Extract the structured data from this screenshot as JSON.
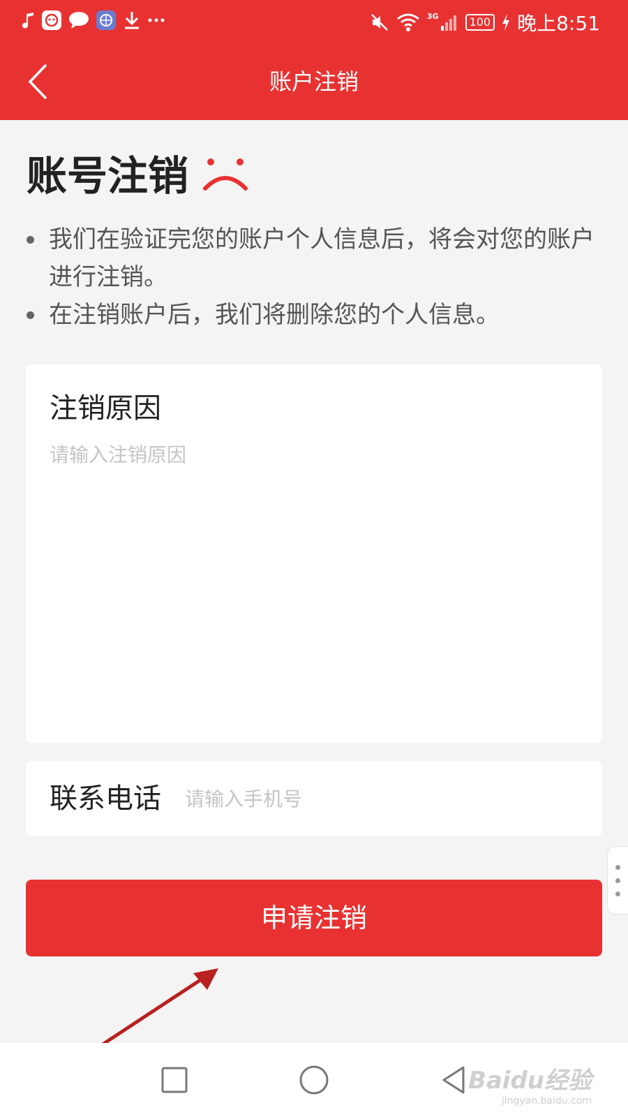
{
  "status_bar": {
    "notification_icons": [
      "music-note-icon",
      "app-icon",
      "chat-bubble-icon",
      "globe-app-icon",
      "download-icon",
      "more-dots-icon"
    ],
    "network": "3G",
    "battery": "100",
    "time": "晚上8:51"
  },
  "nav": {
    "title": "账户注销",
    "back_icon": "chevron-left-icon"
  },
  "heading": {
    "title": "账号注销",
    "icon": "sad-face-icon"
  },
  "notes": [
    "我们在验证完您的账户个人信息后，将会对您的账户进行注销。",
    "在注销账户后，我们将删除您的个人信息。"
  ],
  "reason": {
    "label": "注销原因",
    "placeholder": "请输入注销原因"
  },
  "phone": {
    "label": "联系电话",
    "placeholder": "请输入手机号"
  },
  "submit": {
    "label": "申请注销"
  },
  "system_nav": {
    "buttons": [
      "recents-square-icon",
      "home-circle-icon",
      "back-triangle-icon"
    ]
  },
  "watermark": {
    "brand": "Baidu经验",
    "url": "jingyan.baidu.com"
  },
  "colors": {
    "primary": "#e83232",
    "background": "#f4f4f4",
    "placeholder": "#c4c4c4"
  }
}
